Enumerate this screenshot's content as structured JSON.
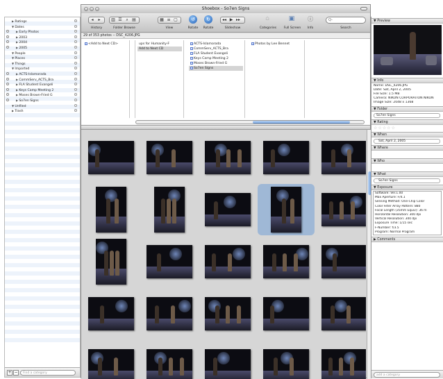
{
  "window": {
    "title": "Shoebox - So7en Signs"
  },
  "toolbar": {
    "history": "History",
    "folder_browse": "Folder Browse",
    "view": "View",
    "rotate": "Rotate",
    "rotate2": "Rotate",
    "slideshow": "Slideshow",
    "categories": "Categories",
    "fullscreen": "Full Screen",
    "info": "Info",
    "search": "Search",
    "search_placeholder": "Q-"
  },
  "status": "29 of 353 photos -- DSC_4206.JPG",
  "left_panel": {
    "categories": [
      {
        "label": "Ratings",
        "arrow": "▶",
        "indent": 10,
        "cb": false
      },
      {
        "label": "Dates",
        "arrow": "▼",
        "indent": 10,
        "cb": false
      },
      {
        "label": "Early Photos",
        "arrow": "▶",
        "indent": 16,
        "cb": true
      },
      {
        "label": "2003",
        "arrow": "▶",
        "indent": 16,
        "cb": true
      },
      {
        "label": "2004",
        "arrow": "▶",
        "indent": 16,
        "cb": true
      },
      {
        "label": "2005",
        "arrow": "▶",
        "indent": 16,
        "cb": true
      },
      {
        "label": "People",
        "arrow": "▼",
        "indent": 10,
        "cb": false
      },
      {
        "label": "Places",
        "arrow": "▼",
        "indent": 10,
        "cb": false
      },
      {
        "label": "Things",
        "arrow": "▼",
        "indent": 10,
        "cb": false
      },
      {
        "label": "Imported",
        "arrow": "▼",
        "indent": 10,
        "cb": false
      },
      {
        "label": "ACTS-Islamorada",
        "arrow": "▶",
        "indent": 16,
        "cb": true
      },
      {
        "label": "CommServ_ACTS_Bra",
        "arrow": "▶",
        "indent": 16,
        "cb": true
      },
      {
        "label": "FLA Student Evangeli",
        "arrow": "▶",
        "indent": 16,
        "cb": true
      },
      {
        "label": "Keys Camp Meeting 2",
        "arrow": "▶",
        "indent": 16,
        "cb": true
      },
      {
        "label": "Moses Brown-Fried G",
        "arrow": "▶",
        "indent": 16,
        "cb": true
      },
      {
        "label": "So7en Signs",
        "arrow": "▶",
        "indent": 16,
        "cb": true
      },
      {
        "label": "Unfiled",
        "arrow": "▼",
        "indent": 10,
        "cb": false
      },
      {
        "label": "Trash",
        "arrow": "▶",
        "indent": 10,
        "cb": false
      }
    ],
    "add_btn": "+",
    "remove_btn": "−",
    "find_placeholder": "Find a category"
  },
  "browser": {
    "col1": [
      "<Add to Next CD>"
    ],
    "col2": [
      "ups for Humanity-F",
      "Add to Next CD"
    ],
    "col3": [
      "ACTS-Islamorada",
      "CommServ_ACTS_Bra",
      "FLA Student Evangeli",
      "Keys Camp Meeting 2",
      "Moses Brown-Fried G",
      "So7en Signs"
    ],
    "col4": [
      "Photos by Lee Bennet"
    ]
  },
  "inspector": {
    "preview": "Preview",
    "info": "Info",
    "name": "Name: DSC_4206.JPG",
    "date": "Date: Sat, April 2, 2005",
    "filesize": "File Size: 1.5 MB",
    "camera": "Camera: NIKON CORPORATION NIKON",
    "imagesize": "Image Size: 2048 x 1368",
    "folder": "Folder",
    "folder_value": "So7en Signs",
    "rating": "Rating",
    "stars": "☆☆☆☆☆",
    "when": "When",
    "when_value": "Sat, April 2, 2005",
    "where": "Where",
    "who": "Who",
    "what": "What",
    "what_value": "So7en Signs",
    "exposure": "Exposure",
    "exif": [
      "Software: Ver.1.00",
      "Max Aperture: F/4.1",
      "Sensing Method: One-Chip Color",
      "Color Filter Array Pattern: 880",
      "Focal Length (35mm Equiv): 36 m",
      "Horizontal Resolution: 300 dpi",
      "Vertical Resolution: 300 dpi",
      "Exposure Time: 1/15 sec",
      "F-Number: f/3.5",
      "Program: Normal Program"
    ],
    "comments": "Comments",
    "add_category_placeholder": "add a category"
  },
  "photos_count": 25
}
